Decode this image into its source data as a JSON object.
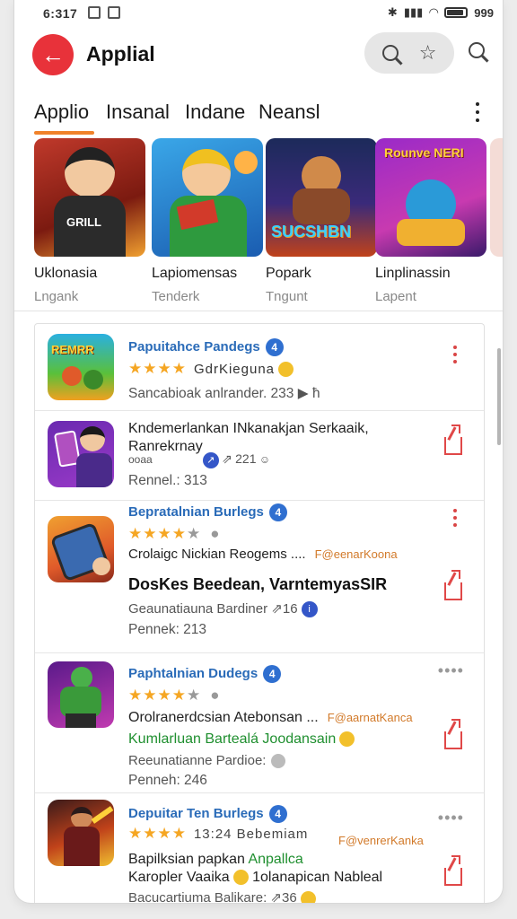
{
  "status": {
    "time": "6:317",
    "battery": "999"
  },
  "appbar": {
    "title": "Applial"
  },
  "tabs": [
    {
      "label": "Applio"
    },
    {
      "label": "Insanal"
    },
    {
      "label": "Indane"
    },
    {
      "label": "Neansl"
    }
  ],
  "carousel": [
    {
      "title": "Uklonasia",
      "subtitle": "Lngank",
      "art": "GRILL"
    },
    {
      "title": "Lapiomensas",
      "subtitle": "Tenderk",
      "art": ""
    },
    {
      "title": "Popark",
      "subtitle": "Tngunt",
      "art": "SUCSHBN"
    },
    {
      "title": "Linplinassin",
      "subtitle": "Lapent",
      "art": "Rounve NERI"
    }
  ],
  "list": [
    {
      "title": "Papuitahce Pandegs",
      "badge": "4",
      "line1": "GdrKieguna",
      "line2": "Sancabioak anlrander. 233",
      "line2_suffix": "ħ",
      "art": "REMRR"
    },
    {
      "title": "Kndemerlankan INkanakjan Serkaaik,",
      "title2": "Ranrekrnay",
      "meta": "ooaa",
      "meta_count": "221",
      "line2": "Rennel.: 313"
    },
    {
      "title": "Bepratalnian Burlegs",
      "badge": "4",
      "line1": "Crolaigc Nickian Reogems ....",
      "line1_tag": "F@eenarKoona",
      "line2": "DosKes Beedean, VarntemyasSIR",
      "line3": "Geaunatiauna Bardiner",
      "line3_count": "16",
      "line4": "Pennek: 213"
    },
    {
      "title": "Paphtalnian Dudegs",
      "badge": "4",
      "line1": "Orolranerdcsian Atebonsan ...",
      "line1_tag": "F@aarnatKanca",
      "line2": "Kumlarluan Bartealá Joodansain",
      "line3": "Reeunatianne Pardioe:",
      "line4": "Penneh: 246"
    },
    {
      "title": "Depuitar Ten Burlegs",
      "badge": "4",
      "line1": "13:24 Bebemiam",
      "line1_tag": "F@venrerKanka",
      "line2a": "Bapilksian papkan",
      "line2b": "Anpallca",
      "line3a": "Karopler Vaaika",
      "line3b": "1olanapican Nableal",
      "line4": "Bacucartiuma Balikare:",
      "line4_count": "36"
    }
  ],
  "colors": {
    "accent": "#e8323a",
    "tab_indicator": "#f0822a",
    "link": "#2a6bb8"
  }
}
